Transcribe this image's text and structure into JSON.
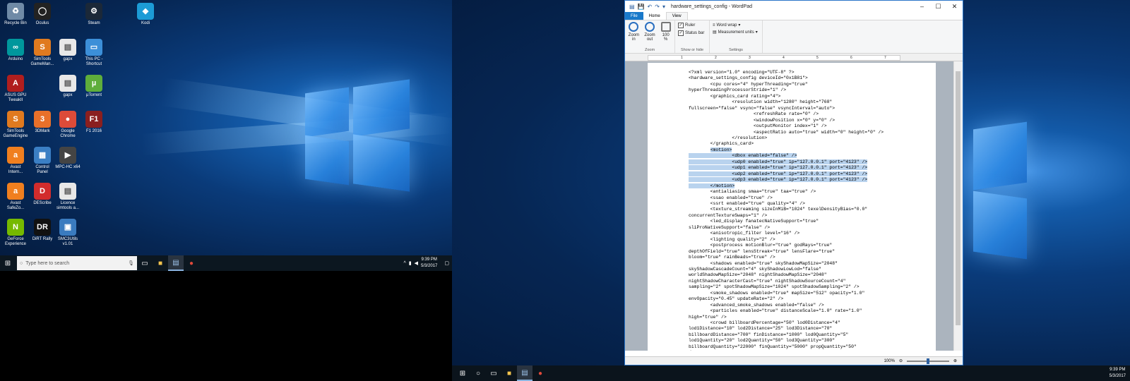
{
  "desktop_icons": [
    {
      "label": "Recycle Bin",
      "icon": "recycle-bin-icon",
      "color": "#6f8aa6",
      "glyph": "♻"
    },
    {
      "label": "Oculus",
      "icon": "oculus-icon",
      "color": "#222222",
      "glyph": "◯"
    },
    {
      "label": "Steam",
      "icon": "steam-icon",
      "color": "#1b2838",
      "glyph": "⚙"
    },
    {
      "label": "Kodi",
      "icon": "kodi-icon",
      "color": "#1c9bd6",
      "glyph": "◆"
    },
    {
      "label": "Arduino",
      "icon": "arduino-icon",
      "color": "#00979c",
      "glyph": "∞"
    },
    {
      "label": "SimTools GameMan...",
      "icon": "simtools-icon",
      "color": "#e07a1f",
      "glyph": "S"
    },
    {
      "label": "gapx",
      "icon": "file-icon",
      "color": "#e8e8e8",
      "glyph": "▤"
    },
    {
      "label": "This PC - Shortcut",
      "icon": "computer-icon",
      "color": "#3c8fd8",
      "glyph": "▭"
    },
    {
      "label": "ASUS GPU TweakII",
      "icon": "asus-icon",
      "color": "#b01e1e",
      "glyph": "A"
    },
    {
      "label": "gapx",
      "icon": "file-icon",
      "color": "#e8e8e8",
      "glyph": "▤"
    },
    {
      "label": "µTorrent",
      "icon": "utorrent-icon",
      "color": "#5fae3b",
      "glyph": "µ"
    },
    {
      "label": "SimTools GameEngine",
      "icon": "simtools-icon",
      "color": "#e07a1f",
      "glyph": "S"
    },
    {
      "label": "3DMark",
      "icon": "3dmark-icon",
      "color": "#e8702a",
      "glyph": "3"
    },
    {
      "label": "Google Chrome",
      "icon": "chrome-icon",
      "color": "#dd4b39",
      "glyph": "●"
    },
    {
      "label": "F1 2016",
      "icon": "f1-icon",
      "color": "#8a1f1f",
      "glyph": "F1"
    },
    {
      "label": "Avast Intern...",
      "icon": "avast-icon",
      "color": "#f07f1f",
      "glyph": "a"
    },
    {
      "label": "Control Panel",
      "icon": "control-panel-icon",
      "color": "#3b7fc4",
      "glyph": "▦"
    },
    {
      "label": "MPC-HC x64",
      "icon": "mpc-icon",
      "color": "#444444",
      "glyph": "▶"
    },
    {
      "label": "Avast SafeZo...",
      "icon": "avast-icon",
      "color": "#f07f1f",
      "glyph": "a"
    },
    {
      "label": "DEScribe",
      "icon": "describe-icon",
      "color": "#d22c2c",
      "glyph": "D"
    },
    {
      "label": "Licence simtools a...",
      "icon": "file-icon",
      "color": "#e8e8e8",
      "glyph": "▤"
    },
    {
      "label": "GeForce Experience",
      "icon": "geforce-icon",
      "color": "#76b900",
      "glyph": "N"
    },
    {
      "label": "DiRT Rally",
      "icon": "dirt-icon",
      "color": "#111111",
      "glyph": "DR"
    },
    {
      "label": "SMC3Utils v1.01",
      "icon": "smc3-icon",
      "color": "#3a7bbf",
      "glyph": "▣"
    }
  ],
  "taskbar": {
    "search_placeholder": "Type here to search",
    "time": "9:39 PM",
    "date": "5/3/2017"
  },
  "wordpad": {
    "title": "hardware_settings_config - WordPad",
    "tabs": [
      "File",
      "Home",
      "View"
    ],
    "ribbon": {
      "zoom_in": "Zoom in",
      "zoom_out": "Zoom out",
      "zoom_100": "100 %",
      "zoom_group": "Zoom",
      "ruler": "Ruler",
      "status_bar": "Status bar",
      "show_hide_group": "Show or hide",
      "word_wrap": "Word wrap",
      "measurement_units": "Measurement units",
      "settings_group": "Settings"
    },
    "ruler_marks": [
      "1",
      "2",
      "3",
      "4",
      "5",
      "6",
      "7"
    ],
    "zoom_level": "100%",
    "doc_before": "<?xml version=\"1.0\" encoding=\"UTF-8\" ?>\n<hardware_settings_config deviceId=\"0x1B81\">\n        <cpu cores=\"4\" hyperThreading=\"true\"\nhyperThreadingProcessorStride=\"1\" />\n        <graphics_card rating=\"4\">\n                <resolution width=\"1280\" height=\"768\"\nfullscreen=\"false\" vsync=\"false\" vsyncInterval=\"auto\">\n                        <refreshRate rate=\"0\" />\n                        <windowPosition x=\"0\" y=\"0\" />\n                        <outputMonitor index=\"1\" />\n                        <aspectRatio auto=\"true\" width=\"0\" height=\"0\" />\n                </resolution>\n        </graphics_card>\n        ",
    "doc_selected": "<motion>\n                <dbox enabled=\"false\" />\n                <udp0 enabled=\"true\" ip=\"127.0.0.1\" port=\"4123\" />\n                <udp1 enabled=\"true\" ip=\"127.0.0.1\" port=\"4123\" />\n                <udp2 enabled=\"true\" ip=\"127.0.0.1\" port=\"4123\" />\n                <udp3 enabled=\"true\" ip=\"127.0.0.1\" port=\"4123\" />\n        </motion>",
    "doc_after": "\n        <antialiasing smaa=\"true\" taa=\"true\" />\n        <ssao enabled=\"true\" />\n        <ssrt enabled=\"true\" quality=\"4\" />\n        <texture_streaming sizeInMiB=\"1024\" texelDensityBias=\"0.0\"\nconcurrentTextureSwaps=\"1\" />\n        <led_display fanatecNativeSupport=\"true\"\nsliProNativeSupport=\"false\" />\n        <anisotropic_filter level=\"16\" />\n        <lighting quality=\"2\" />\n        <postprocess motionBlur=\"true\" godRays=\"true\"\ndepthOfField=\"true\" lensStreak=\"true\" lensFlare=\"true\"\nbloom=\"true\" rainBeads=\"true\" />\n        <shadows enabled=\"true\" skyShadowMapSize=\"2048\"\nskyShadowCascadeCount=\"4\" skyShadowLowLod=\"false\"\nworldShadowMapSize=\"2048\" nightShadowMapSize=\"2048\"\nnightShadowCharacterCast=\"true\" nightShadowSourceCount=\"4\"\nsampling=\"2\" spotShadowMapSize=\"1024\" spotShadowSampling=\"2\" />\n        <smoke_shadows enabled=\"true\" mapSize=\"512\" opacity=\"1.0\"\nenvOpacity=\"0.45\" updateRate=\"2\" />\n        <advanced_smoke_shadows enabled=\"false\" />\n        <particles enabled=\"true\" distanceScale=\"1.0\" rate=\"1.0\"\nhigh=\"true\" />\n        <crowd billboardPercentage=\"50\" lod0Distance=\"4\"\nlod1Distance=\"10\" lod2Distance=\"25\" lod3Distance=\"70\"\nbillboardDistance=\"700\" finDistance=\"1000\" lod0Quantity=\"5\"\nlod1Quantity=\"20\" lod2Quantity=\"50\" lod3Quantity=\"300\"\nbillboardQuantity=\"22000\" finQuantity=\"5000\" propQuantity=\"50\"\n/>"
  }
}
